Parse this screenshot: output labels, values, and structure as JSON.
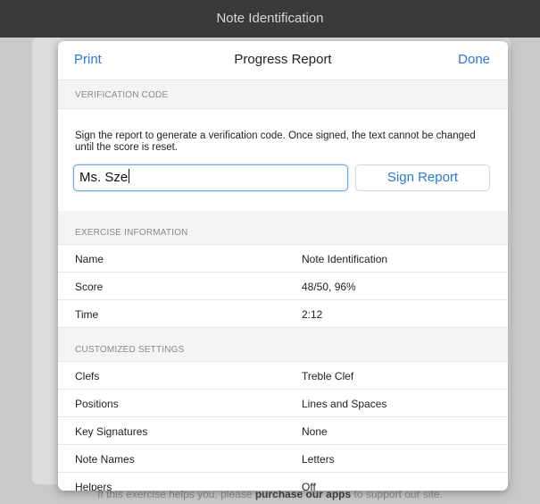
{
  "window": {
    "title": "Note Identification"
  },
  "modal": {
    "print_label": "Print",
    "title": "Progress Report",
    "done_label": "Done"
  },
  "verification": {
    "section_title": "VERIFICATION CODE",
    "description": "Sign the report to generate a verification code. Once signed, the text cannot be changed until the score is reset.",
    "name_value": "Ms. Sze",
    "sign_label": "Sign Report"
  },
  "exercise": {
    "section_title": "EXERCISE INFORMATION",
    "rows": [
      {
        "key": "Name",
        "value": "Note Identification"
      },
      {
        "key": "Score",
        "value": "48/50, 96%"
      },
      {
        "key": "Time",
        "value": "2:12"
      }
    ]
  },
  "settings": {
    "section_title": "CUSTOMIZED SETTINGS",
    "rows": [
      {
        "key": "Clefs",
        "value": "Treble Clef"
      },
      {
        "key": "Positions",
        "value": "Lines and Spaces"
      },
      {
        "key": "Key Signatures",
        "value": "None"
      },
      {
        "key": "Note Names",
        "value": "Letters"
      },
      {
        "key": "Helpers",
        "value": "Off"
      }
    ]
  },
  "footer": {
    "prefix": "If this exercise helps you, please ",
    "link": "purchase our apps",
    "suffix": " to support our site."
  }
}
